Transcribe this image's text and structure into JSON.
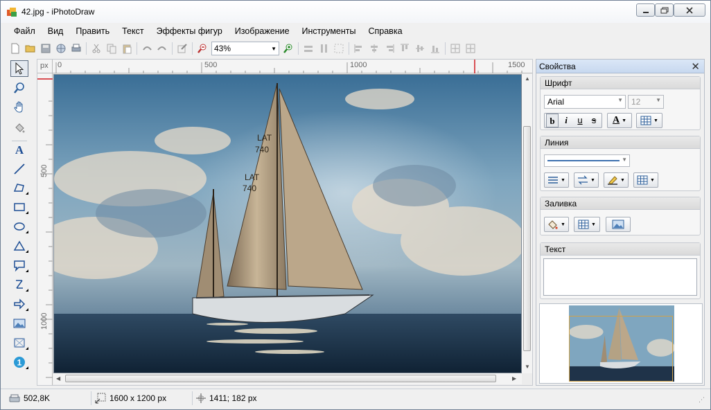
{
  "window": {
    "title": "42.jpg - iPhotoDraw",
    "minimize": "—",
    "maximize": "▢",
    "close": "✕"
  },
  "menu": [
    "Файл",
    "Вид",
    "Править",
    "Текст",
    "Эффекты фигур",
    "Изображение",
    "Инструменты",
    "Справка"
  ],
  "toolbar": {
    "zoom_value": "43%"
  },
  "ruler": {
    "unit": "px",
    "h_labels": [
      "0",
      "500",
      "1000",
      "1500"
    ],
    "v_labels": [
      "500",
      "1000"
    ]
  },
  "properties": {
    "title": "Свойства",
    "close": "✕",
    "font_group": {
      "title": "Шрифт",
      "font_name": "Arial",
      "font_size": "12",
      "bold": "b",
      "italic": "i",
      "underline": "u",
      "strike": "s",
      "color_letter": "A"
    },
    "line_group": {
      "title": "Линия"
    },
    "fill_group": {
      "title": "Заливка"
    },
    "text_group": {
      "title": "Текст"
    }
  },
  "status": {
    "file_size": "502,8K",
    "image_size": "1600 x 1200 px",
    "cursor_pos": "1411; 182 px"
  },
  "colors": {
    "accent": "#3c7fc4",
    "panel_header": "#c7d8ef",
    "ruler_marker": "#d0191e"
  }
}
